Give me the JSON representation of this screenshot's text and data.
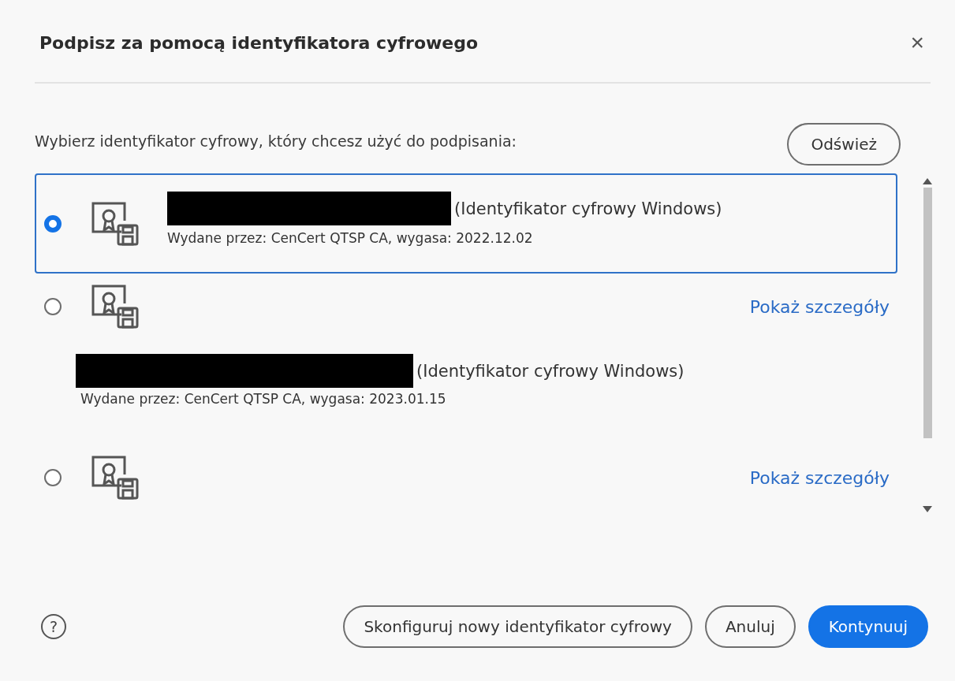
{
  "dialog": {
    "title": "Podpisz za pomocą identyfikatora cyfrowego",
    "close": "×"
  },
  "prompt": "Wybierz identyfikator cyfrowy, który chcesz użyć do podpisania:",
  "refresh_button": "Odśwież",
  "certificates": [
    {
      "kind": "inline",
      "selected": true,
      "redacted": true,
      "name_suffix": "(Identyfikator cyfrowy Windows)",
      "issuer": "Wydane przez: CenCert QTSP CA, wygasa: 2022.12.02"
    },
    {
      "kind": "expanded",
      "selected": false,
      "redacted": true,
      "details_link": "Pokaż szczegóły",
      "name_suffix": "(Identyfikator cyfrowy Windows)",
      "issuer": "Wydane przez: CenCert QTSP CA, wygasa: 2023.01.15"
    },
    {
      "kind": "collapsed",
      "selected": false,
      "details_link": "Pokaż szczegóły"
    }
  ],
  "footer": {
    "help": "?",
    "buttons": [
      {
        "label": "Skonfiguruj nowy identyfikator cyfrowy",
        "primary": false
      },
      {
        "label": "Anuluj",
        "primary": false
      },
      {
        "label": "Kontynuuj",
        "primary": true
      }
    ]
  }
}
